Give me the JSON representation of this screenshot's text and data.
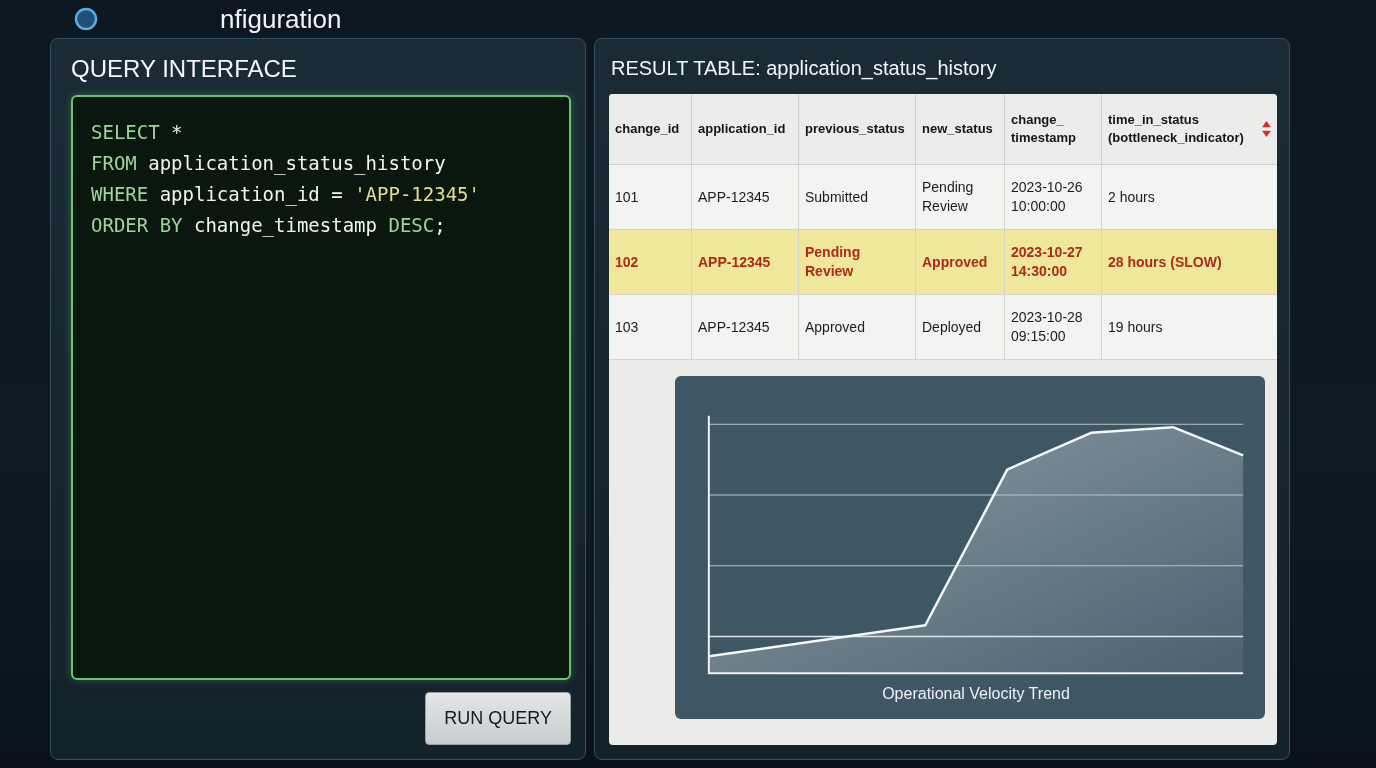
{
  "header": {
    "title": "nfiguration"
  },
  "query_panel": {
    "title": "QUERY INTERFACE",
    "code_lines": [
      {
        "tokens": [
          {
            "kind": "keyword",
            "text": "SELECT"
          },
          {
            "kind": "plain",
            "text": "*"
          }
        ]
      },
      {
        "tokens": [
          {
            "kind": "keyword",
            "text": "FROM"
          },
          {
            "kind": "plain",
            "text": "application_status_history"
          }
        ]
      },
      {
        "tokens": [
          {
            "kind": "keyword",
            "text": "WHERE"
          },
          {
            "kind": "plain",
            "text": "application_id ="
          },
          {
            "kind": "string",
            "text": "'APP-12345'"
          }
        ]
      },
      {
        "tokens": [
          {
            "kind": "keyword",
            "text": "ORDER BY"
          },
          {
            "kind": "plain",
            "text": "change_timestamp"
          },
          {
            "kind": "keyword",
            "text": "DESC"
          },
          {
            "kind": "punct",
            "text": ";"
          }
        ]
      }
    ],
    "run_button": "RUN QUERY"
  },
  "results_panel": {
    "title": "RESULT TABLE: application_status_history",
    "table": {
      "columns": [
        {
          "label": "change_id",
          "sortable": false
        },
        {
          "label": "application_id",
          "sortable": false
        },
        {
          "label": "previous_status",
          "sortable": false
        },
        {
          "label": "new_status",
          "sortable": false
        },
        {
          "label": "change_timestamp",
          "sortable": false
        },
        {
          "label": "time_in_status (bottleneck_indicator)",
          "sortable": true
        }
      ],
      "rows": [
        {
          "highlighted": false,
          "cells": [
            "101",
            "APP-12345",
            "Submitted",
            "Pending Review",
            "2023-10-26 10:00:00",
            "2 hours"
          ]
        },
        {
          "highlighted": true,
          "cells": [
            "102",
            "APP-12345",
            "Pending Review",
            "Approved",
            "2023-10-27 14:30:00",
            "28 hours (SLOW)"
          ]
        },
        {
          "highlighted": false,
          "cells": [
            "103",
            "APP-12345",
            "Approved",
            "Deployed",
            "2023-10-28 09:15:00",
            "19 hours"
          ]
        }
      ]
    },
    "chart": {
      "caption": "Operational Velocity Trend"
    }
  }
}
